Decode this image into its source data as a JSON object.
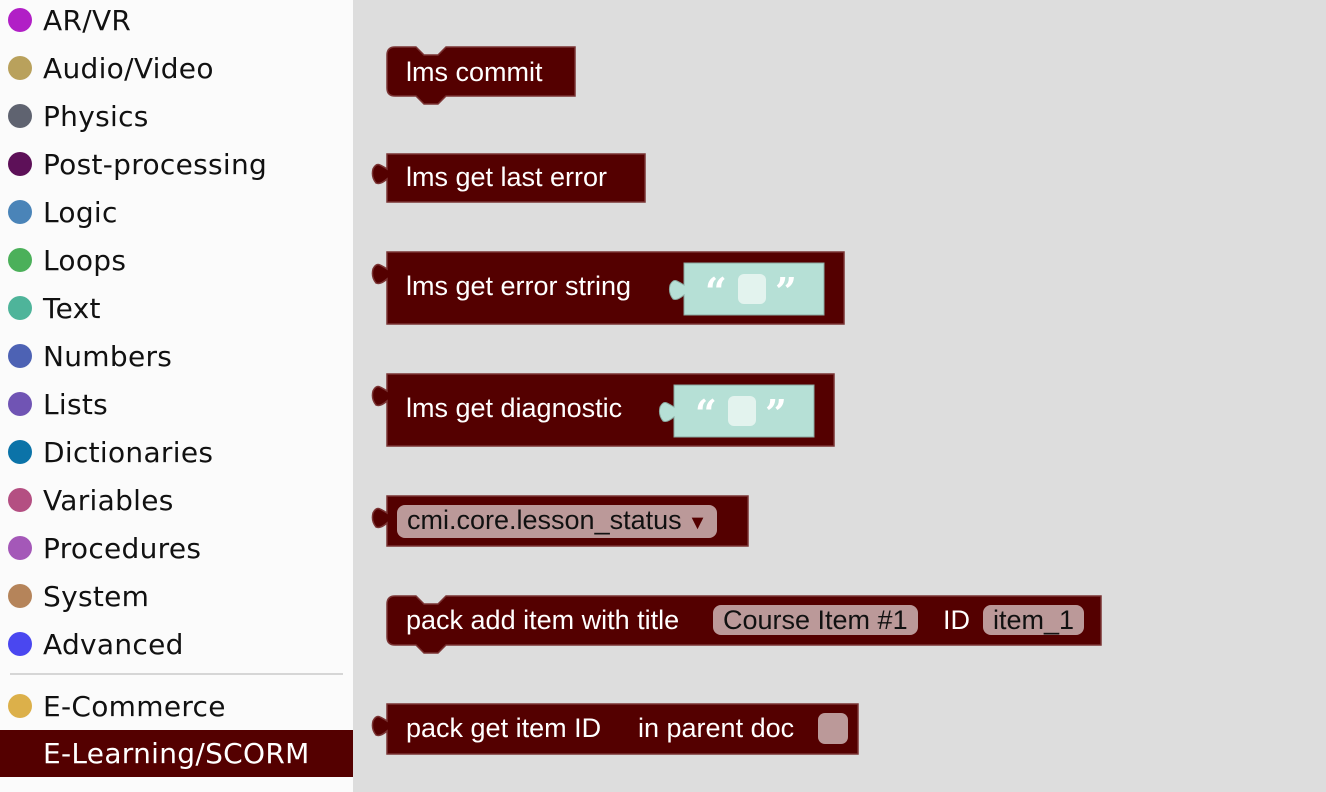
{
  "colors": {
    "block": "#540000",
    "block_edge": "#7a3333",
    "text_block": "#b6e0d6",
    "field_bg": "#bb9999",
    "selected_category": "#540000"
  },
  "sidebar": {
    "categories": [
      {
        "label": "AR/VR",
        "color": "#b11fc6"
      },
      {
        "label": "Audio/Video",
        "color": "#b9a15c"
      },
      {
        "label": "Physics",
        "color": "#5f6370"
      },
      {
        "label": "Post-processing",
        "color": "#5d1058"
      },
      {
        "label": "Logic",
        "color": "#4a84b8"
      },
      {
        "label": "Loops",
        "color": "#4bb05a"
      },
      {
        "label": "Text",
        "color": "#4eb49a"
      },
      {
        "label": "Numbers",
        "color": "#4d62b4"
      },
      {
        "label": "Lists",
        "color": "#7054b4"
      },
      {
        "label": "Dictionaries",
        "color": "#0b73a8"
      },
      {
        "label": "Variables",
        "color": "#b44f82"
      },
      {
        "label": "Procedures",
        "color": "#a458b8"
      },
      {
        "label": "System",
        "color": "#b5845a"
      },
      {
        "label": "Advanced",
        "color": "#4a47f0"
      }
    ],
    "extensions": [
      {
        "label": "E-Commerce",
        "color": "#dcb04a"
      },
      {
        "label": "E-Learning/SCORM",
        "color": "#540000",
        "selected": true
      }
    ]
  },
  "blocks": {
    "lms_commit": {
      "text": "lms commit"
    },
    "lms_get_last_error": {
      "text": "lms get last error"
    },
    "lms_get_error_string": {
      "text": "lms get error string",
      "open_quote": "“",
      "close_quote": "”",
      "value": ""
    },
    "lms_get_diagnostic": {
      "text": "lms get diagnostic",
      "open_quote": "“",
      "close_quote": "”",
      "value": ""
    },
    "cmi_dropdown": {
      "selected": "cmi.core.lesson_status",
      "arrow": "▼"
    },
    "pack_add_item": {
      "text": "pack add item with title",
      "title_value": "Course Item #1",
      "id_label": "ID",
      "id_value": "item_1"
    },
    "pack_get_item_id": {
      "text": "pack get item ID",
      "text2": "in parent doc",
      "checkbox_value": ""
    }
  }
}
